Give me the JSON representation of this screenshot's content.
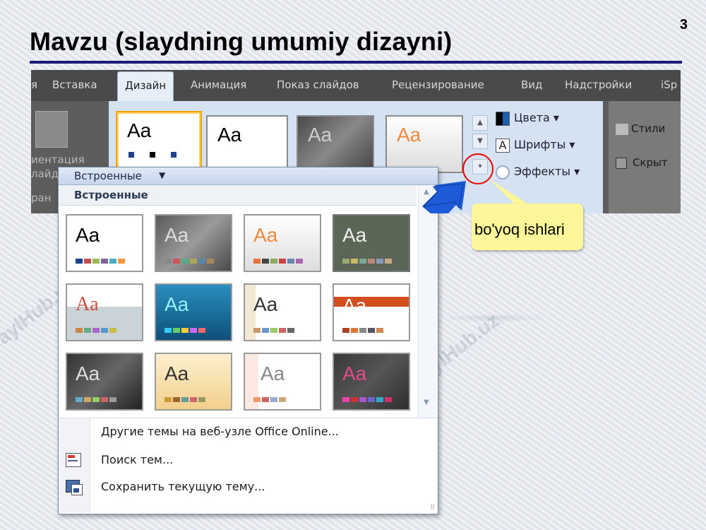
{
  "slide": {
    "number": "3",
    "title": "Mavzu (slaydning umumiy dizayni)"
  },
  "watermark": "FaylHub.uz",
  "ribbon": {
    "tabs": [
      "я",
      "Вставка",
      "Дизайн",
      "Анимация",
      "Показ слайдов",
      "Рецензирование",
      "Вид",
      "Надстройки",
      "iSp"
    ],
    "active_tab": "Дизайн",
    "left_fragments": [
      "иентация",
      "лайд",
      "ран"
    ],
    "theme_thumb_label": "Aa",
    "theme_options": {
      "colors": "Цвета",
      "fonts": "Шрифты",
      "effects": "Эффекты"
    },
    "right_fragments": {
      "styles": "Стили",
      "hide": "Скрыт"
    }
  },
  "gallery": {
    "header": "Встроенные",
    "section_title": "Встроенные",
    "thumb_label": "Aa",
    "links": {
      "online": "Другие темы на веб-узле Office Online...",
      "search": "Поиск тем...",
      "save": "Сохранить текущую тему..."
    }
  },
  "callout": {
    "text": "bo'yoq ishlari"
  },
  "colors": {
    "accent_arrow": "#1e5bd8",
    "highlight_circle": "#e00000",
    "callout_bg": "#fdf69a",
    "title_rule": "#1a1a7a"
  }
}
